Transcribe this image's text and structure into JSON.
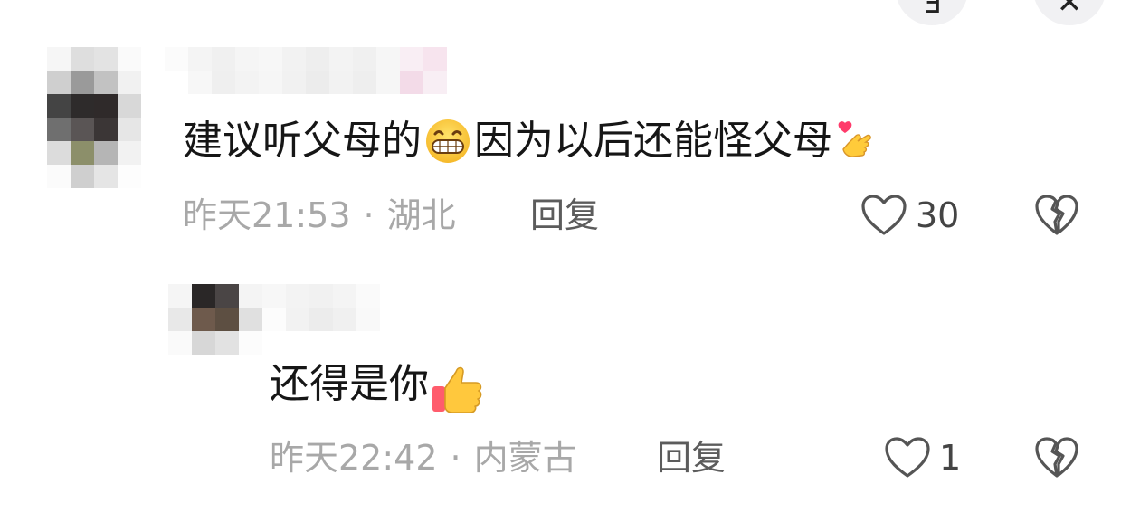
{
  "top_bar": {
    "left_button_icon": "partial-button-icon",
    "right_button_icon": "close-icon"
  },
  "comments": [
    {
      "avatar_icon": "pixelated-avatar",
      "username_blurred": true,
      "text_part1": "建议听父母的",
      "emoji1": "grinning-face-emoji",
      "text_part2": "因为以后还能怪父母",
      "emoji2": "heart-hands-emoji",
      "time": "昨天21:53",
      "separator": "·",
      "location": "湖北",
      "reply_label": "回复",
      "like_count": "30"
    },
    {
      "avatar_icon": "pixelated-avatar",
      "username_blurred": true,
      "text_part1": "还得是你",
      "emoji1": "thumbs-up-emoji",
      "time": "昨天22:42",
      "separator": "·",
      "location": "内蒙古",
      "reply_label": "回复",
      "like_count": "1"
    }
  ],
  "colors": {
    "text_primary": "#161616",
    "meta_gray": "#a8a8a8",
    "reply_gray": "#5c5c5c",
    "icon_gray": "#555555"
  }
}
